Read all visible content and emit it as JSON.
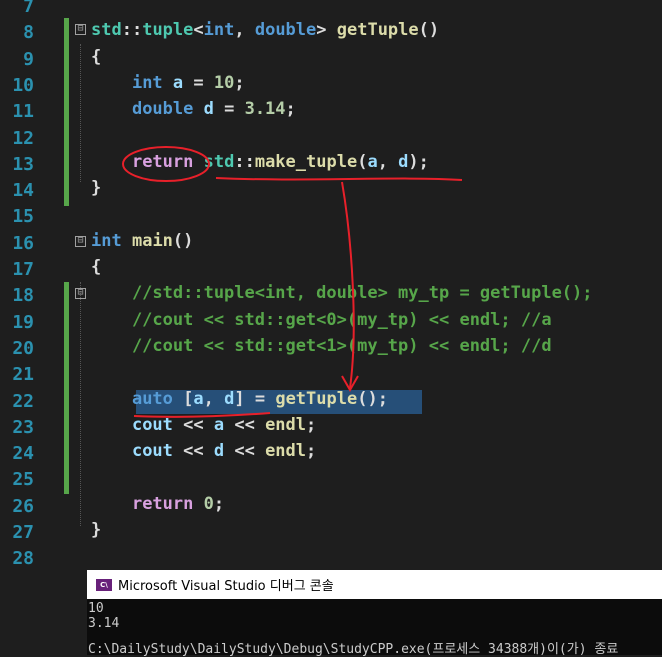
{
  "editor": {
    "lines": [
      {
        "n": "7"
      },
      {
        "n": "8",
        "parts": [
          [
            "ns",
            "std"
          ],
          [
            "",
            "::"
          ],
          [
            "ty",
            "tuple"
          ],
          [
            "",
            "<"
          ],
          [
            "kw",
            "int"
          ],
          [
            "",
            ", "
          ],
          [
            "kw",
            "double"
          ],
          [
            "",
            "> "
          ],
          [
            "fn",
            "getTuple"
          ],
          [
            "",
            "()"
          ]
        ]
      },
      {
        "n": "9",
        "parts": [
          [
            "",
            "{"
          ]
        ]
      },
      {
        "n": "10",
        "parts": [
          [
            "",
            "    "
          ],
          [
            "kw",
            "int"
          ],
          [
            "var",
            " a"
          ],
          [
            "",
            " = "
          ],
          [
            "num",
            "10"
          ],
          [
            "",
            ";"
          ]
        ]
      },
      {
        "n": "11",
        "parts": [
          [
            "",
            "    "
          ],
          [
            "kw",
            "double"
          ],
          [
            "var",
            " d"
          ],
          [
            "",
            " = "
          ],
          [
            "num",
            "3.14"
          ],
          [
            "",
            ";"
          ]
        ]
      },
      {
        "n": "12"
      },
      {
        "n": "13",
        "parts": [
          [
            "",
            "    "
          ],
          [
            "ctl",
            "return"
          ],
          [
            "",
            " "
          ],
          [
            "ns",
            "std"
          ],
          [
            "",
            "::"
          ],
          [
            "fn",
            "make_tuple"
          ],
          [
            "",
            "("
          ],
          [
            "var",
            "a"
          ],
          [
            "",
            ", "
          ],
          [
            "var",
            "d"
          ],
          [
            "",
            ");"
          ]
        ]
      },
      {
        "n": "14",
        "parts": [
          [
            "",
            "}"
          ]
        ]
      },
      {
        "n": "15"
      },
      {
        "n": "16",
        "parts": [
          [
            "kw",
            "int"
          ],
          [
            "",
            " "
          ],
          [
            "fn",
            "main"
          ],
          [
            "",
            "()"
          ]
        ]
      },
      {
        "n": "17",
        "parts": [
          [
            "",
            "{"
          ]
        ]
      },
      {
        "n": "18",
        "parts": [
          [
            "cmt",
            "    //std::tuple<int, double> my_tp = getTuple();"
          ]
        ]
      },
      {
        "n": "19",
        "parts": [
          [
            "cmt",
            "    //cout << std::get<0>(my_tp) << endl; //a"
          ]
        ]
      },
      {
        "n": "20",
        "parts": [
          [
            "cmt",
            "    //cout << std::get<1>(my_tp) << endl; //d"
          ]
        ]
      },
      {
        "n": "21"
      },
      {
        "n": "22",
        "parts": [
          [
            "",
            "    "
          ],
          [
            "kw",
            "auto"
          ],
          [
            "",
            " ["
          ],
          [
            "var",
            "a"
          ],
          [
            "",
            ", "
          ],
          [
            "var",
            "d"
          ],
          [
            "",
            "] = "
          ],
          [
            "fn",
            "getTuple"
          ],
          [
            "",
            "();"
          ]
        ]
      },
      {
        "n": "23",
        "parts": [
          [
            "",
            "    "
          ],
          [
            "var",
            "cout"
          ],
          [
            "",
            " << "
          ],
          [
            "var",
            "a"
          ],
          [
            "",
            " << "
          ],
          [
            "fn",
            "endl"
          ],
          [
            "",
            ";"
          ]
        ]
      },
      {
        "n": "24",
        "parts": [
          [
            "",
            "    "
          ],
          [
            "var",
            "cout"
          ],
          [
            "",
            " << "
          ],
          [
            "var",
            "d"
          ],
          [
            "",
            " << "
          ],
          [
            "fn",
            "endl"
          ],
          [
            "",
            ";"
          ]
        ]
      },
      {
        "n": "25"
      },
      {
        "n": "26",
        "parts": [
          [
            "",
            "    "
          ],
          [
            "ctl",
            "return"
          ],
          [
            "",
            " "
          ],
          [
            "num",
            "0"
          ],
          [
            "",
            ";"
          ]
        ]
      },
      {
        "n": "27",
        "parts": [
          [
            "",
            "}"
          ]
        ]
      },
      {
        "n": "28"
      }
    ],
    "fold_markers": [
      "⊟",
      "⊟",
      "⊟"
    ]
  },
  "console": {
    "title": "Microsoft Visual Studio 디버그 콘솔",
    "icon_label": "C\\",
    "output": [
      "10",
      "3.14",
      "C:\\DailyStudy\\DailyStudy\\Debug\\StudyCPP.exe(프로세스 34388개)이(가) 종료"
    ]
  },
  "colors": {
    "annotation": "#e8202a",
    "selection": "#264f78",
    "keyword": "#569cd6"
  }
}
